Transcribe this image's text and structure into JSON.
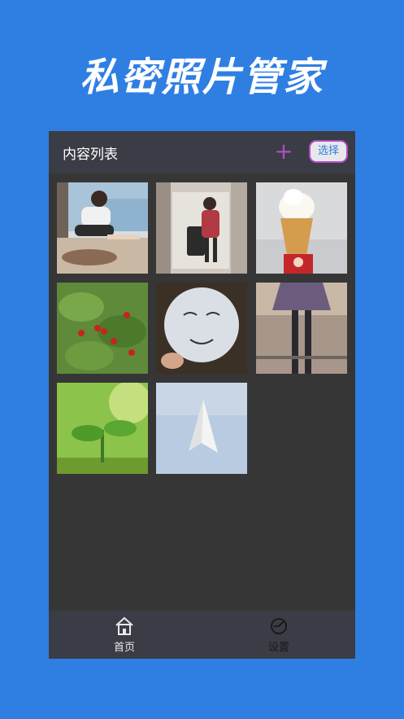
{
  "promo": {
    "title": "私密照片管家"
  },
  "navbar": {
    "title": "内容列表",
    "add_label": "+",
    "select_label": "选择"
  },
  "photos": [
    {
      "name": "photo-woman-window",
      "icon": "photo"
    },
    {
      "name": "photo-mirror-selfie",
      "icon": "photo"
    },
    {
      "name": "photo-ice-cream",
      "icon": "photo"
    },
    {
      "name": "photo-cherry-tree",
      "icon": "photo"
    },
    {
      "name": "photo-balloon-face",
      "icon": "photo"
    },
    {
      "name": "photo-skirt-rails",
      "icon": "photo"
    },
    {
      "name": "photo-sprout",
      "icon": "photo"
    },
    {
      "name": "photo-paper-plane",
      "icon": "photo"
    }
  ],
  "tabbar": {
    "home_label": "首页",
    "settings_label": "设置",
    "home_icon": "home-icon",
    "settings_icon": "settings-icon"
  },
  "colors": {
    "background": "#2f7fe3",
    "panel": "#363636",
    "bar": "#3a3d45",
    "accent": "#b24cc4"
  }
}
